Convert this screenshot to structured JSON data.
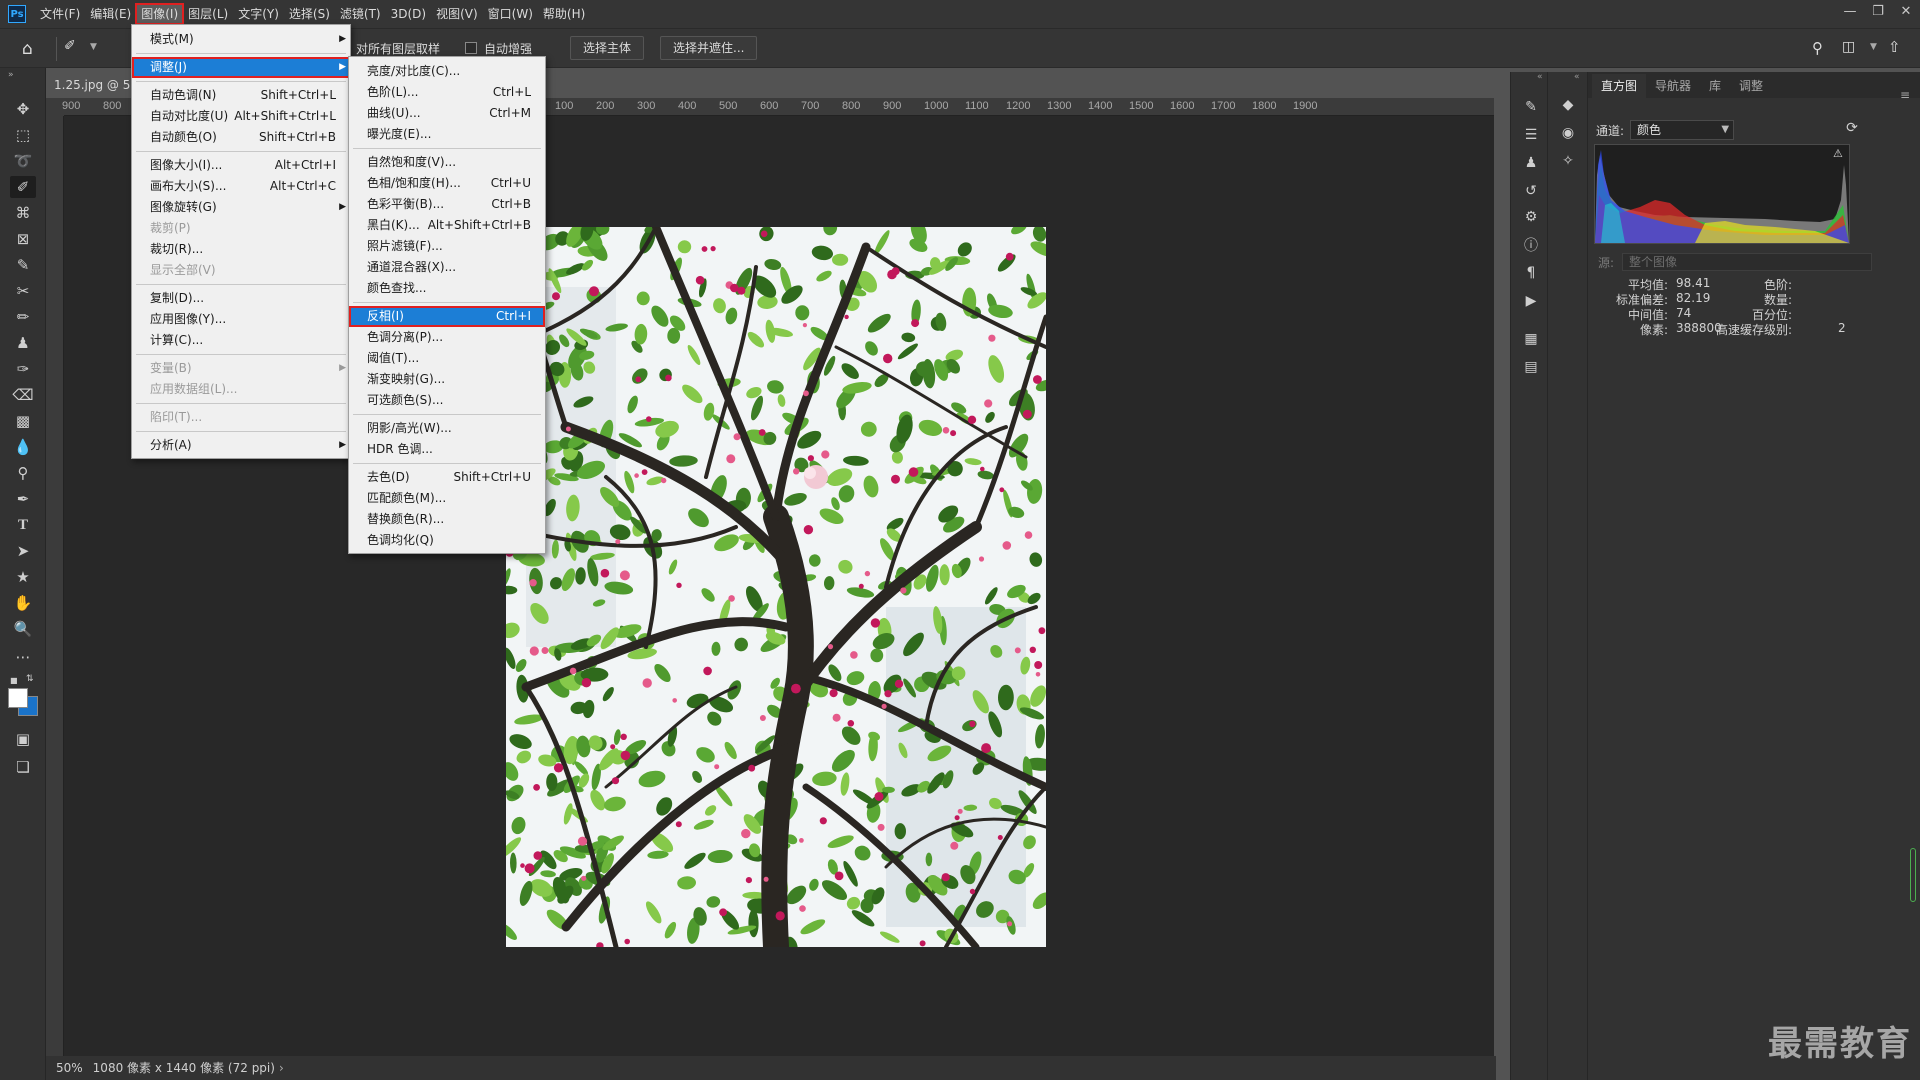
{
  "app": {
    "logo": "Ps",
    "menu": [
      "文件(F)",
      "编辑(E)",
      "图像(I)",
      "图层(L)",
      "文字(Y)",
      "选择(S)",
      "滤镜(T)",
      "3D(D)",
      "视图(V)",
      "窗口(W)",
      "帮助(H)"
    ],
    "active_menu_index": 2
  },
  "options_bar": {
    "sample_all_layers": "对所有图层取样",
    "auto_enhance": "自动增强",
    "select_subject": "选择主体",
    "select_and_mask": "选择并遮住..."
  },
  "document": {
    "tab_title": "1.25.jpg @ 50",
    "zoom": "50%",
    "info": "1080 像素 x 1440 像素 (72 ppi)",
    "ruler_ticks": [
      "900",
      "800",
      "100",
      "200",
      "300",
      "400",
      "500",
      "600",
      "700",
      "800",
      "900",
      "1000",
      "1100",
      "1200",
      "1300",
      "1400",
      "1500",
      "1600",
      "1700",
      "1800",
      "1900"
    ]
  },
  "image_menu": [
    {
      "label": "模式(M)",
      "submenu": true
    },
    {
      "sep": true
    },
    {
      "label": "调整(J)",
      "submenu": true,
      "highlight": true
    },
    {
      "sep": true
    },
    {
      "label": "自动色调(N)",
      "shortcut": "Shift+Ctrl+L"
    },
    {
      "label": "自动对比度(U)",
      "shortcut": "Alt+Shift+Ctrl+L"
    },
    {
      "label": "自动颜色(O)",
      "shortcut": "Shift+Ctrl+B"
    },
    {
      "sep": true
    },
    {
      "label": "图像大小(I)...",
      "shortcut": "Alt+Ctrl+I"
    },
    {
      "label": "画布大小(S)...",
      "shortcut": "Alt+Ctrl+C"
    },
    {
      "label": "图像旋转(G)",
      "submenu": true
    },
    {
      "label": "裁剪(P)",
      "disabled": true
    },
    {
      "label": "裁切(R)..."
    },
    {
      "label": "显示全部(V)",
      "disabled": true
    },
    {
      "sep": true
    },
    {
      "label": "复制(D)..."
    },
    {
      "label": "应用图像(Y)..."
    },
    {
      "label": "计算(C)..."
    },
    {
      "sep": true
    },
    {
      "label": "变量(B)",
      "submenu": true,
      "disabled": true
    },
    {
      "label": "应用数据组(L)...",
      "disabled": true
    },
    {
      "sep": true
    },
    {
      "label": "陷印(T)...",
      "disabled": true
    },
    {
      "sep": true
    },
    {
      "label": "分析(A)",
      "submenu": true
    }
  ],
  "adjust_menu": [
    {
      "label": "亮度/对比度(C)..."
    },
    {
      "label": "色阶(L)...",
      "shortcut": "Ctrl+L"
    },
    {
      "label": "曲线(U)...",
      "shortcut": "Ctrl+M"
    },
    {
      "label": "曝光度(E)..."
    },
    {
      "sep": true
    },
    {
      "label": "自然饱和度(V)..."
    },
    {
      "label": "色相/饱和度(H)...",
      "shortcut": "Ctrl+U"
    },
    {
      "label": "色彩平衡(B)...",
      "shortcut": "Ctrl+B"
    },
    {
      "label": "黑白(K)...",
      "shortcut": "Alt+Shift+Ctrl+B"
    },
    {
      "label": "照片滤镜(F)..."
    },
    {
      "label": "通道混合器(X)..."
    },
    {
      "label": "颜色查找..."
    },
    {
      "sep": true
    },
    {
      "label": "反相(I)",
      "shortcut": "Ctrl+I",
      "highlight": true
    },
    {
      "label": "色调分离(P)..."
    },
    {
      "label": "阈值(T)..."
    },
    {
      "label": "渐变映射(G)..."
    },
    {
      "label": "可选颜色(S)..."
    },
    {
      "sep": true
    },
    {
      "label": "阴影/高光(W)..."
    },
    {
      "label": "HDR 色调..."
    },
    {
      "sep": true
    },
    {
      "label": "去色(D)",
      "shortcut": "Shift+Ctrl+U"
    },
    {
      "label": "匹配颜色(M)..."
    },
    {
      "label": "替换颜色(R)..."
    },
    {
      "label": "色调均化(Q)"
    }
  ],
  "histogram_panel": {
    "tabs": [
      "直方图",
      "导航器",
      "库",
      "调整"
    ],
    "channel_label": "通道:",
    "channel_value": "颜色",
    "source_label": "源:",
    "source_value": "整个图像",
    "stats_left": [
      {
        "label": "平均值:",
        "value": "98.41"
      },
      {
        "label": "标准偏差:",
        "value": "82.19"
      },
      {
        "label": "中间值:",
        "value": "74"
      },
      {
        "label": "像素:",
        "value": "388800"
      }
    ],
    "stats_right": [
      {
        "label": "色阶:",
        "value": ""
      },
      {
        "label": "数量:",
        "value": ""
      },
      {
        "label": "百分位:",
        "value": ""
      },
      {
        "label": "高速缓存级别:",
        "value": "2"
      }
    ]
  },
  "watermark": "最需教育",
  "colors": {
    "menu_highlight": "#1c7ed6",
    "highlight_border": "#e02020",
    "ps_blue": "#31a8ff"
  }
}
